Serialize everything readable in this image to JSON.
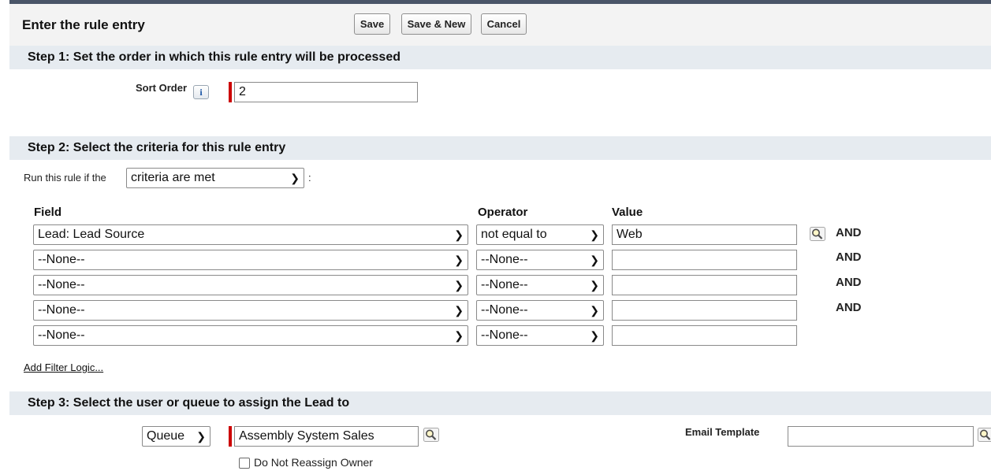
{
  "header": {
    "title": "Enter the rule entry",
    "save_label": "Save",
    "save_new_label": "Save & New",
    "cancel_label": "Cancel"
  },
  "step1": {
    "heading": "Step 1: Set the order in which this rule entry will be processed",
    "sort_order_label": "Sort Order",
    "info_glyph": "i",
    "sort_order_value": "2"
  },
  "step2": {
    "heading": "Step 2: Select the criteria for this rule entry",
    "run_rule_prefix": "Run this rule if the",
    "run_rule_value": "criteria are met",
    "run_rule_suffix": ":",
    "columns": {
      "field": "Field",
      "operator": "Operator",
      "value": "Value"
    },
    "rows": [
      {
        "field": "Lead: Lead Source",
        "operator": "not equal to",
        "value": "Web",
        "conj": "AND"
      },
      {
        "field": "--None--",
        "operator": "--None--",
        "value": "",
        "conj": "AND"
      },
      {
        "field": "--None--",
        "operator": "--None--",
        "value": "",
        "conj": "AND"
      },
      {
        "field": "--None--",
        "operator": "--None--",
        "value": "",
        "conj": "AND"
      },
      {
        "field": "--None--",
        "operator": "--None--",
        "value": "",
        "conj": ""
      }
    ],
    "add_filter_logic": "Add Filter Logic..."
  },
  "step3": {
    "heading": "Step 3: Select the user or queue to assign the Lead to",
    "assign_type": "Queue",
    "assign_value": "Assembly System Sales",
    "email_template_label": "Email Template",
    "email_template_value": "",
    "do_not_reassign_label": "Do Not Reassign Owner",
    "do_not_reassign_checked": false
  },
  "icons": {
    "dropdown": "chevron-down-icon",
    "lookup": "lookup-magnifier-icon",
    "info": "info-icon"
  },
  "colors": {
    "required_bar": "#cc0000",
    "section_bg": "#e6ebf0",
    "header_bg": "#f3f3f3"
  }
}
